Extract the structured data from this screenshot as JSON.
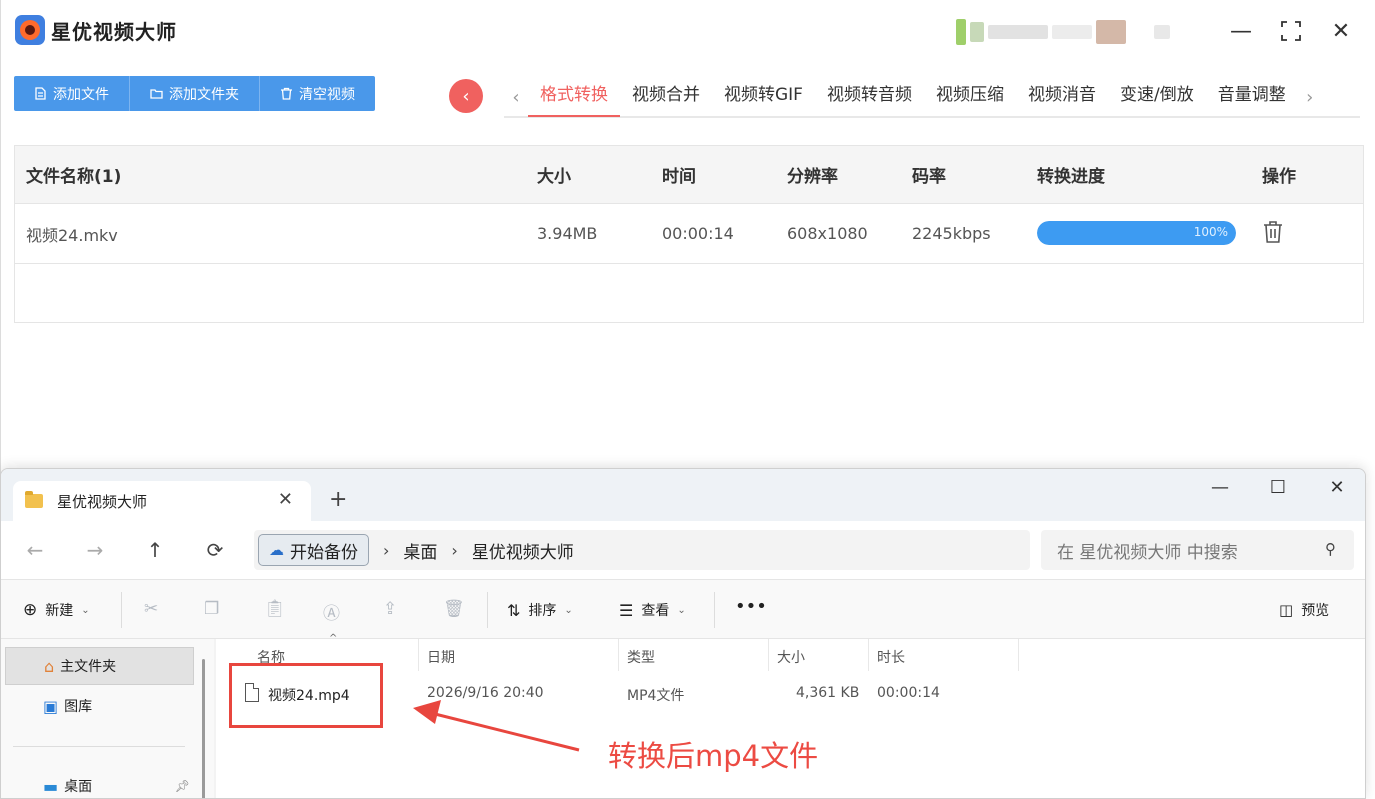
{
  "app": {
    "title": "星优视频大师",
    "toolbar": [
      {
        "label": "添加文件",
        "icon": "file-icon"
      },
      {
        "label": "添加文件夹",
        "icon": "folder-icon"
      },
      {
        "label": "清空视频",
        "icon": "trash-icon"
      }
    ],
    "tabs": [
      "格式转换",
      "视频合并",
      "视频转GIF",
      "视频转音频",
      "视频压缩",
      "视频消音",
      "变速/倒放",
      "音量调整"
    ],
    "active_tab": "格式转换",
    "accent_color": "#f0615f",
    "table": {
      "headers": [
        "文件名称(1)",
        "大小",
        "时间",
        "分辨率",
        "码率",
        "转换进度",
        "操作"
      ],
      "rows": [
        {
          "name": "视频24.mkv",
          "size": "3.94MB",
          "time": "00:00:14",
          "resolution": "608x1080",
          "bitrate": "2245kbps",
          "progress": 100,
          "progress_label": "100%"
        }
      ]
    }
  },
  "explorer": {
    "tab_title": "星优视频大师",
    "breadcrumb": [
      "开始备份",
      "桌面",
      "星优视频大师"
    ],
    "search_placeholder": "在 星优视频大师 中搜索",
    "commands": {
      "new": "新建",
      "sort": "排序",
      "view": "查看",
      "preview": "预览"
    },
    "sidebar": [
      "主文件夹",
      "图库",
      "桌面"
    ],
    "columns": [
      "名称",
      "日期",
      "类型",
      "大小",
      "时长"
    ],
    "files": [
      {
        "name": "视频24.mp4",
        "date": "2026/9/16 20:40",
        "type": "MP4文件",
        "size": "4,361 KB",
        "duration": "00:00:14"
      }
    ]
  },
  "annotation": {
    "text": "转换后mp4文件",
    "color": "#ec4b43"
  }
}
